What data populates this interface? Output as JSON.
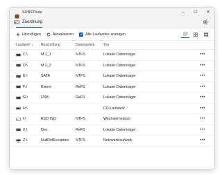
{
  "window": {
    "title": "SUBSTitute",
    "controls": {
      "minimize": "─",
      "maximize": "☐",
      "close": "✕"
    }
  },
  "tabs": [
    {
      "label": "Zuordnung"
    }
  ],
  "toolbar": {
    "add_label": "Hinzufügen",
    "refresh_label": "Aktualisieren",
    "show_all_label": "Alle Laufwerke anzeigen",
    "show_all_checked": true
  },
  "table": {
    "headers": {
      "drive": "Laufwerk",
      "label": "Beschriftung",
      "fs": "Dateisystem",
      "type": "Typ",
      "sort_arrow": "↑"
    },
    "rows": [
      {
        "drive": "C:\\",
        "label": "M.2_1",
        "fs": "NTFS",
        "type": "Lokaler Datenträger",
        "icon": "drive-icon",
        "more": "•••"
      },
      {
        "drive": "D:\\",
        "label": "M.2_2",
        "fs": "NTFS",
        "type": "Lokaler Datenträger",
        "icon": "drive-icon",
        "more": "•••"
      },
      {
        "drive": "E:\\",
        "label": "SATA",
        "fs": "NTFS",
        "type": "Lokaler Datenträger",
        "icon": "drive-icon",
        "more": "•••"
      },
      {
        "drive": "F:\\",
        "label": "Extern",
        "fs": "ReFS",
        "type": "Lokaler Datenträger",
        "icon": "drive-icon",
        "more": "•••"
      },
      {
        "drive": "G:\\",
        "label": "USB",
        "fs": "ReFS",
        "type": "Lokaler Datenträger",
        "icon": "drive-icon",
        "more": "•••"
      },
      {
        "drive": "H:\\",
        "label": "",
        "fs": "",
        "type": "CD-Laufwerk",
        "icon": "cd-drive-icon",
        "more": "•••"
      },
      {
        "drive": "I:\\",
        "label": "ESD-ISO",
        "fs": "NTFS",
        "type": "Wechselmedium",
        "icon": "removable-drive-icon",
        "more": "•••"
      },
      {
        "drive": "X:\\",
        "label": "Dev",
        "fs": "ReFS",
        "type": "Lokaler Datenträger",
        "icon": "drive-icon",
        "more": "•••"
      },
      {
        "drive": "Z:\\",
        "label": "NullRefException",
        "fs": "NTFS",
        "type": "Netzwerklaufwerk",
        "icon": "network-drive-icon",
        "more": "•••"
      }
    ]
  },
  "colors": {
    "accent": "#0067c0",
    "content_bg": "#ffffff",
    "chrome_bg": "#f3f3f3"
  }
}
